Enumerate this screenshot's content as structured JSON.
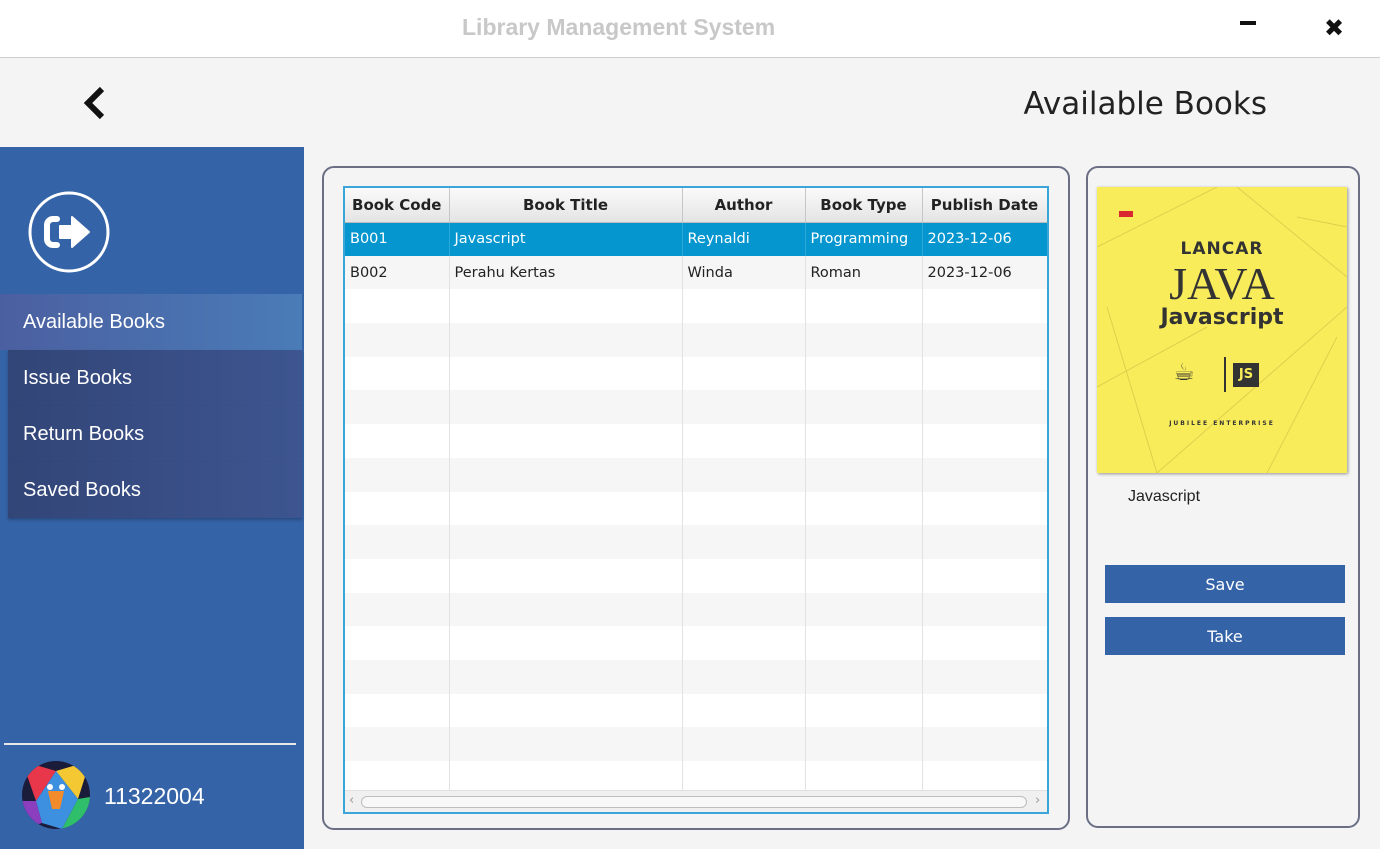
{
  "window": {
    "title": "Library Management System",
    "minimize_icon": "minimize-icon",
    "close_icon": "close-icon"
  },
  "header": {
    "back_icon": "chevron-left-icon",
    "page_title": "Available Books"
  },
  "sidebar": {
    "logout_icon": "logout-icon",
    "items": [
      {
        "label": "Available Books",
        "active": true
      },
      {
        "label": "Issue Books",
        "active": false
      },
      {
        "label": "Return Books",
        "active": false
      },
      {
        "label": "Saved Books",
        "active": false
      }
    ],
    "user_id": "11322004",
    "colors": {
      "background": "#3563a8",
      "active": "#4a7cb8"
    }
  },
  "table": {
    "columns": [
      "Book Code",
      "Book Title",
      "Author",
      "Book Type",
      "Publish Date"
    ],
    "rows": [
      [
        "B001",
        "Javascript",
        "Reynaldi",
        "Programming",
        "2023-12-06"
      ],
      [
        "B002",
        "Perahu Kertas",
        "Winda",
        "Roman",
        "2023-12-06"
      ]
    ],
    "selected_row": 0,
    "selection_color": "#0596cf",
    "empty_rows": 15
  },
  "detail": {
    "cover": {
      "line1": "LANCAR",
      "line2": "JAVA",
      "line3": "Javascript",
      "badge": "JS",
      "publisher": "JUBILEE ENTERPRISE",
      "background": "#f9ec5a"
    },
    "book_title": "Javascript",
    "save_label": "Save",
    "take_label": "Take"
  }
}
